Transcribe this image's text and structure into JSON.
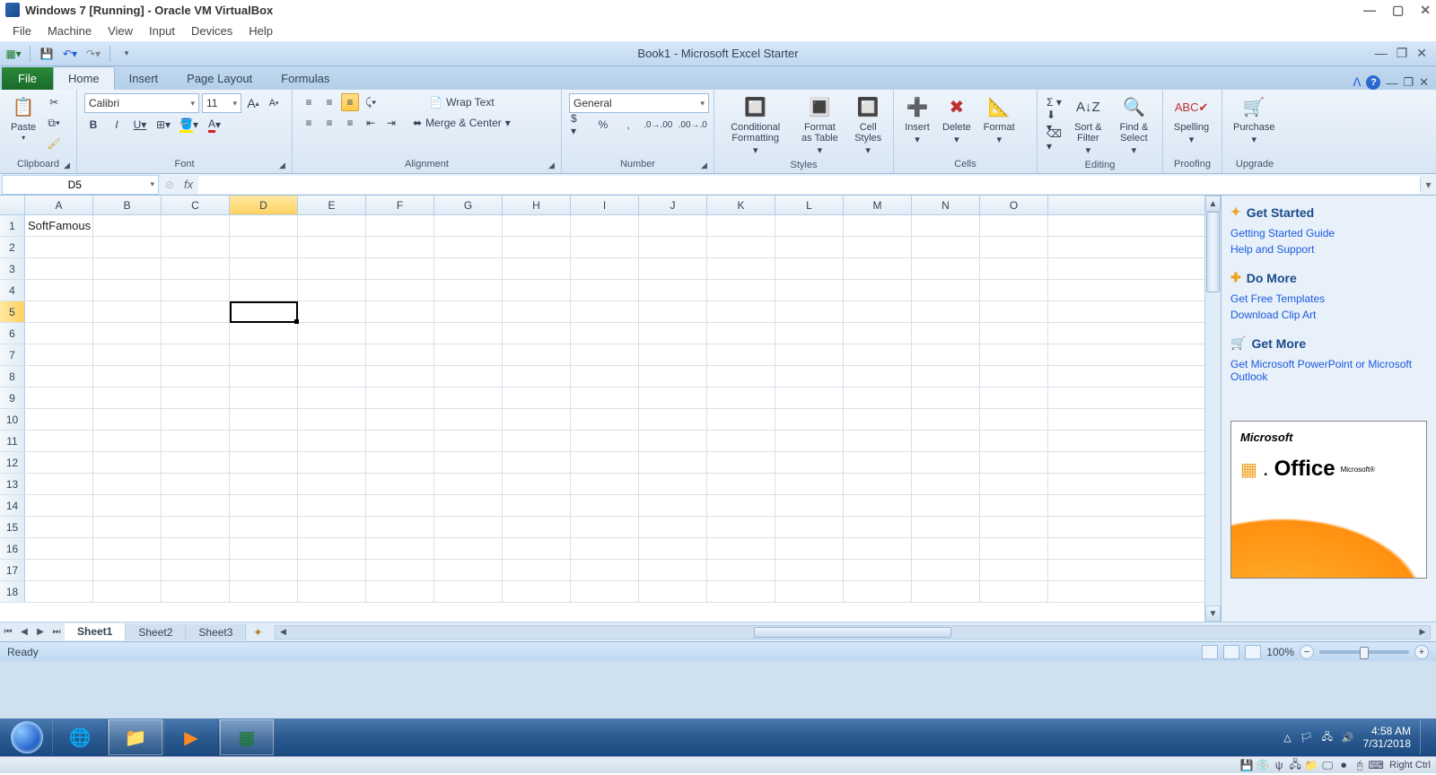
{
  "vb": {
    "title": "Windows 7 [Running] - Oracle VM VirtualBox",
    "menus": [
      "File",
      "Machine",
      "View",
      "Input",
      "Devices",
      "Help"
    ],
    "strip_label": "Right Ctrl"
  },
  "excel": {
    "title": "Book1  -  Microsoft Excel Starter",
    "tabs": {
      "file": "File",
      "items": [
        "Home",
        "Insert",
        "Page Layout",
        "Formulas"
      ],
      "active": 0
    },
    "ribbon": {
      "clipboard": {
        "label": "Clipboard",
        "paste": "Paste"
      },
      "font": {
        "label": "Font",
        "name": "Calibri",
        "size": "11"
      },
      "alignment": {
        "label": "Alignment",
        "wrap": "Wrap Text",
        "merge": "Merge & Center"
      },
      "number": {
        "label": "Number",
        "format": "General"
      },
      "styles": {
        "label": "Styles",
        "cond": "Conditional Formatting",
        "table": "Format as Table",
        "cell": "Cell Styles"
      },
      "cells": {
        "label": "Cells",
        "insert": "Insert",
        "delete": "Delete",
        "format": "Format"
      },
      "editing": {
        "label": "Editing",
        "sort": "Sort & Filter",
        "find": "Find & Select"
      },
      "proofing": {
        "label": "Proofing",
        "spelling": "Spelling"
      },
      "upgrade": {
        "label": "Upgrade",
        "purchase": "Purchase"
      }
    },
    "namebox": "D5",
    "columns": [
      "A",
      "B",
      "C",
      "D",
      "E",
      "F",
      "G",
      "H",
      "I",
      "J",
      "K",
      "L",
      "M",
      "N",
      "O"
    ],
    "active_col": "D",
    "rows": 18,
    "active_row": 5,
    "cell_A1": "SoftFamous",
    "sheets": [
      "Sheet1",
      "Sheet2",
      "Sheet3"
    ],
    "active_sheet": 0,
    "status": "Ready",
    "zoom": "100%"
  },
  "sidepane": {
    "get_started": {
      "title": "Get Started",
      "links": [
        "Getting Started Guide",
        "Help and Support"
      ]
    },
    "do_more": {
      "title": "Do More",
      "links": [
        "Get Free Templates",
        "Download Clip Art"
      ]
    },
    "get_more": {
      "title": "Get More",
      "links": [
        "Get Microsoft PowerPoint or Microsoft Outlook"
      ]
    },
    "ad": {
      "brand": "Microsoft",
      "product": "Office",
      "tag": "Microsoft®"
    }
  },
  "taskbar": {
    "time": "4:58 AM",
    "date": "7/31/2018"
  }
}
